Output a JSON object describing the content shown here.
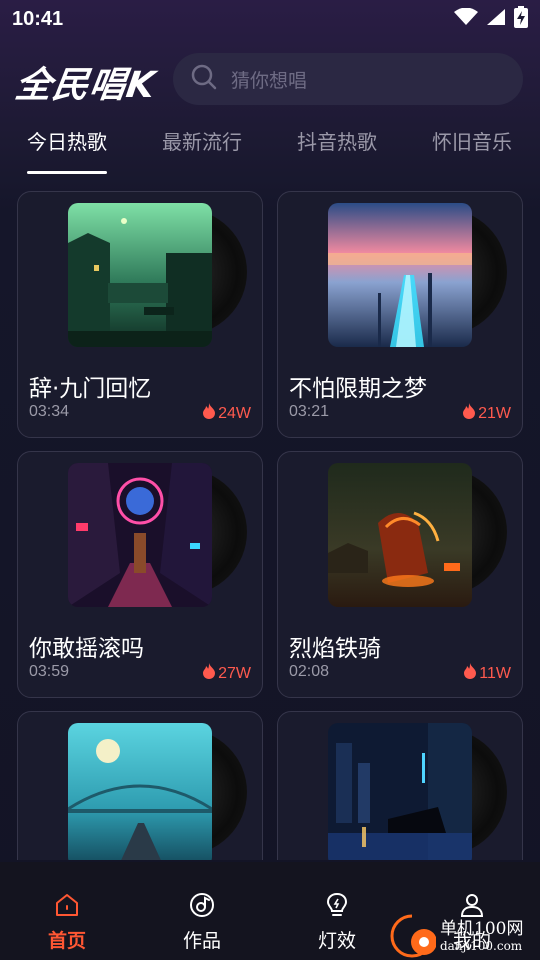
{
  "status_bar": {
    "time": "10:41",
    "icons": [
      "wifi-icon",
      "signal-icon",
      "battery-charging-icon"
    ]
  },
  "header": {
    "logo": "全民唱K",
    "search": {
      "placeholder": "猜你想唱",
      "icon": "search-icon"
    }
  },
  "tabs": [
    {
      "label": "今日热歌",
      "active": true
    },
    {
      "label": "最新流行",
      "active": false
    },
    {
      "label": "抖音热歌",
      "active": false
    },
    {
      "label": "怀旧音乐",
      "active": false
    }
  ],
  "songs": [
    {
      "title": "辞·九门回忆",
      "duration": "03:34",
      "heat": "24W"
    },
    {
      "title": "不怕限期之梦",
      "duration": "03:21",
      "heat": "21W"
    },
    {
      "title": "你敢摇滚吗",
      "duration": "03:59",
      "heat": "27W"
    },
    {
      "title": "烈焰铁骑",
      "duration": "02:08",
      "heat": "11W"
    },
    {
      "title": "",
      "duration": "",
      "heat": ""
    },
    {
      "title": "",
      "duration": "",
      "heat": ""
    }
  ],
  "bottom_nav": [
    {
      "label": "首页",
      "icon": "home-icon",
      "active": true
    },
    {
      "label": "作品",
      "icon": "music-disc-icon",
      "active": false
    },
    {
      "label": "灯效",
      "icon": "lightbulb-icon",
      "active": false
    },
    {
      "label": "我的",
      "icon": "user-icon",
      "active": false
    }
  ],
  "watermark": {
    "line1": "单机100网",
    "line2": "danji100.com"
  },
  "colors": {
    "accent": "#ff5733",
    "heat": "#ff5a4e",
    "background": "#131425"
  }
}
